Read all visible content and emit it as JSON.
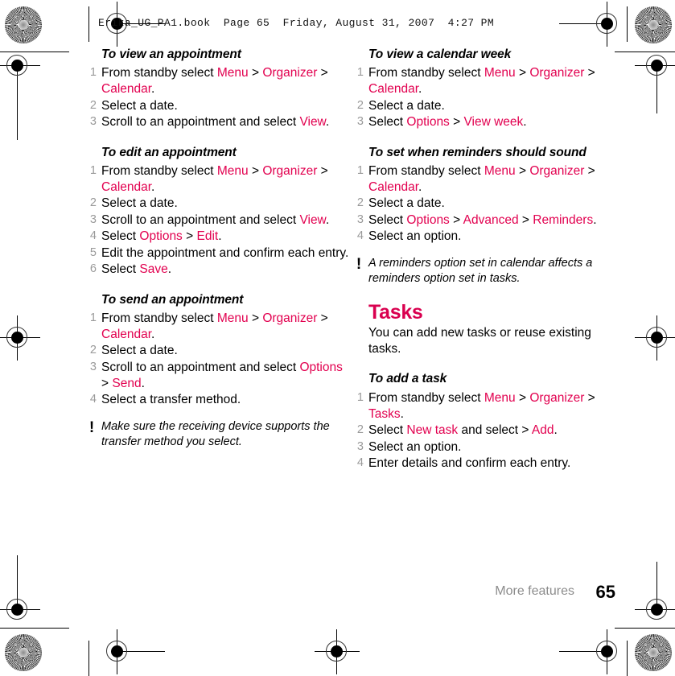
{
  "print_header": {
    "text": "Erika_UG_PA1.book  Page 65  Friday, August 31, 2007  4:27 PM"
  },
  "colors": {
    "ui_term": "#E2004F",
    "section_heading": "#D9004F",
    "step_number": "#9a9a9a",
    "footer_label": "#8c8c8c",
    "body_text": "#000000"
  },
  "marks": {
    "starburst": "starburst-resolution-target",
    "registration": "registration-crosshair-mark"
  },
  "left_column": {
    "procedures": [
      {
        "heading": "To view an appointment",
        "steps": [
          {
            "num": "1",
            "parts": [
              {
                "t": "From standby select ",
                "ui": false
              },
              {
                "t": "Menu",
                "ui": true
              },
              {
                "t": " > ",
                "ui": false
              },
              {
                "t": "Organizer",
                "ui": true
              },
              {
                "t": " > ",
                "ui": false
              },
              {
                "t": "Calendar",
                "ui": true
              },
              {
                "t": ".",
                "ui": false
              }
            ]
          },
          {
            "num": "2",
            "parts": [
              {
                "t": "Select a date.",
                "ui": false
              }
            ]
          },
          {
            "num": "3",
            "parts": [
              {
                "t": "Scroll to an appointment and select ",
                "ui": false
              },
              {
                "t": "View",
                "ui": true
              },
              {
                "t": ".",
                "ui": false
              }
            ]
          }
        ]
      },
      {
        "heading": "To edit an appointment",
        "steps": [
          {
            "num": "1",
            "parts": [
              {
                "t": "From standby select ",
                "ui": false
              },
              {
                "t": "Menu",
                "ui": true
              },
              {
                "t": " > ",
                "ui": false
              },
              {
                "t": "Organizer",
                "ui": true
              },
              {
                "t": " > ",
                "ui": false
              },
              {
                "t": "Calendar",
                "ui": true
              },
              {
                "t": ".",
                "ui": false
              }
            ]
          },
          {
            "num": "2",
            "parts": [
              {
                "t": "Select a date.",
                "ui": false
              }
            ]
          },
          {
            "num": "3",
            "parts": [
              {
                "t": "Scroll to an appointment and select ",
                "ui": false
              },
              {
                "t": "View",
                "ui": true
              },
              {
                "t": ".",
                "ui": false
              }
            ]
          },
          {
            "num": "4",
            "parts": [
              {
                "t": "Select ",
                "ui": false
              },
              {
                "t": "Options",
                "ui": true
              },
              {
                "t": " > ",
                "ui": false
              },
              {
                "t": "Edit",
                "ui": true
              },
              {
                "t": ".",
                "ui": false
              }
            ]
          },
          {
            "num": "5",
            "parts": [
              {
                "t": "Edit the appointment and confirm each entry.",
                "ui": false
              }
            ]
          },
          {
            "num": "6",
            "parts": [
              {
                "t": "Select ",
                "ui": false
              },
              {
                "t": "Save",
                "ui": true
              },
              {
                "t": ".",
                "ui": false
              }
            ]
          }
        ]
      },
      {
        "heading": "To send an appointment",
        "steps": [
          {
            "num": "1",
            "parts": [
              {
                "t": "From standby select ",
                "ui": false
              },
              {
                "t": "Menu",
                "ui": true
              },
              {
                "t": " > ",
                "ui": false
              },
              {
                "t": "Organizer",
                "ui": true
              },
              {
                "t": " > ",
                "ui": false
              },
              {
                "t": "Calendar",
                "ui": true
              },
              {
                "t": ".",
                "ui": false
              }
            ]
          },
          {
            "num": "2",
            "parts": [
              {
                "t": "Select a date.",
                "ui": false
              }
            ]
          },
          {
            "num": "3",
            "parts": [
              {
                "t": "Scroll to an appointment and select ",
                "ui": false
              },
              {
                "t": "Options",
                "ui": true
              },
              {
                "t": " > ",
                "ui": false
              },
              {
                "t": "Send",
                "ui": true
              },
              {
                "t": ".",
                "ui": false
              }
            ]
          },
          {
            "num": "4",
            "parts": [
              {
                "t": "Select a transfer method.",
                "ui": false
              }
            ]
          }
        ]
      }
    ],
    "note": {
      "icon": "exclamation-mark-icon",
      "text": "Make sure the receiving device supports the transfer method you select."
    }
  },
  "right_column": {
    "procedures_top": [
      {
        "heading": "To view a calendar week",
        "steps": [
          {
            "num": "1",
            "parts": [
              {
                "t": "From standby select ",
                "ui": false
              },
              {
                "t": "Menu",
                "ui": true
              },
              {
                "t": " > ",
                "ui": false
              },
              {
                "t": "Organizer",
                "ui": true
              },
              {
                "t": " > ",
                "ui": false
              },
              {
                "t": "Calendar",
                "ui": true
              },
              {
                "t": ".",
                "ui": false
              }
            ]
          },
          {
            "num": "2",
            "parts": [
              {
                "t": "Select a date.",
                "ui": false
              }
            ]
          },
          {
            "num": "3",
            "parts": [
              {
                "t": "Select ",
                "ui": false
              },
              {
                "t": "Options",
                "ui": true
              },
              {
                "t": " > ",
                "ui": false
              },
              {
                "t": "View week",
                "ui": true
              },
              {
                "t": ".",
                "ui": false
              }
            ]
          }
        ]
      },
      {
        "heading": "To set when reminders should sound",
        "steps": [
          {
            "num": "1",
            "parts": [
              {
                "t": "From standby select ",
                "ui": false
              },
              {
                "t": "Menu",
                "ui": true
              },
              {
                "t": " > ",
                "ui": false
              },
              {
                "t": "Organizer",
                "ui": true
              },
              {
                "t": " > ",
                "ui": false
              },
              {
                "t": "Calendar",
                "ui": true
              },
              {
                "t": ".",
                "ui": false
              }
            ]
          },
          {
            "num": "2",
            "parts": [
              {
                "t": "Select a date.",
                "ui": false
              }
            ]
          },
          {
            "num": "3",
            "parts": [
              {
                "t": "Select ",
                "ui": false
              },
              {
                "t": "Options",
                "ui": true
              },
              {
                "t": " > ",
                "ui": false
              },
              {
                "t": "Advanced",
                "ui": true
              },
              {
                "t": " > ",
                "ui": false
              },
              {
                "t": "Reminders",
                "ui": true
              },
              {
                "t": ".",
                "ui": false
              }
            ]
          },
          {
            "num": "4",
            "parts": [
              {
                "t": "Select an option.",
                "ui": false
              }
            ]
          }
        ]
      }
    ],
    "note": {
      "icon": "exclamation-mark-icon",
      "text": "A reminders option set in calendar affects a reminders option set in tasks."
    },
    "section": {
      "title": "Tasks",
      "intro": "You can add new tasks or reuse existing tasks."
    },
    "procedures_bottom": [
      {
        "heading": "To add a task",
        "steps": [
          {
            "num": "1",
            "parts": [
              {
                "t": "From standby select ",
                "ui": false
              },
              {
                "t": "Menu",
                "ui": true
              },
              {
                "t": " > ",
                "ui": false
              },
              {
                "t": "Organizer",
                "ui": true
              },
              {
                "t": " > ",
                "ui": false
              },
              {
                "t": "Tasks",
                "ui": true
              },
              {
                "t": ".",
                "ui": false
              }
            ]
          },
          {
            "num": "2",
            "parts": [
              {
                "t": "Select ",
                "ui": false
              },
              {
                "t": "New task",
                "ui": true
              },
              {
                "t": " and select > ",
                "ui": false
              },
              {
                "t": "Add",
                "ui": true
              },
              {
                "t": ".",
                "ui": false
              }
            ]
          },
          {
            "num": "3",
            "parts": [
              {
                "t": "Select an option.",
                "ui": false
              }
            ]
          },
          {
            "num": "4",
            "parts": [
              {
                "t": "Enter details and confirm each entry.",
                "ui": false
              }
            ]
          }
        ]
      }
    ]
  },
  "footer": {
    "label": "More features",
    "page_number": "65"
  }
}
